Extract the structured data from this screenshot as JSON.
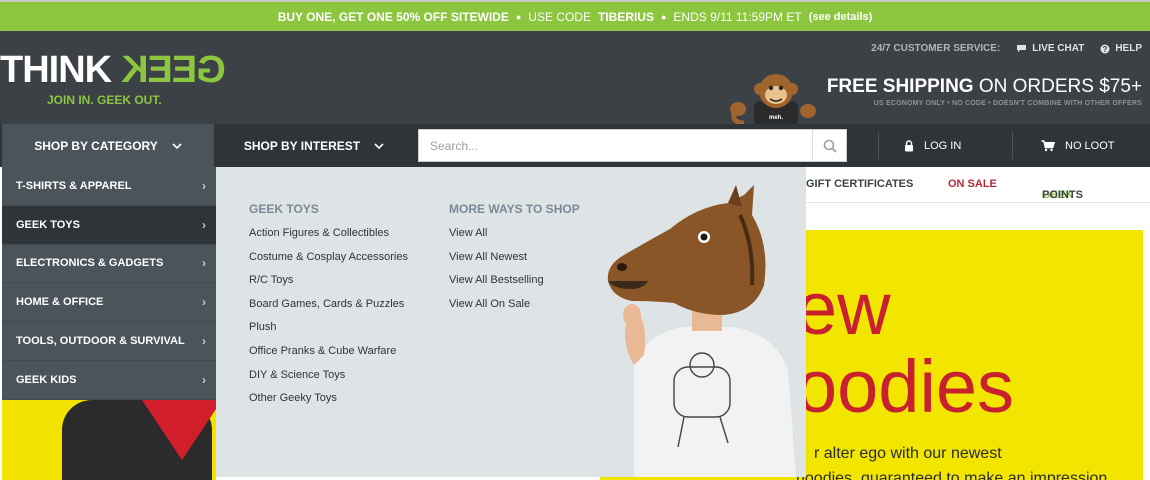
{
  "promo": {
    "offer": "BUY ONE, GET ONE 50% OFF SITEWIDE",
    "dot": "●",
    "code_label": "USE CODE",
    "code": "TIBERIUS",
    "ends": "ENDS 9/11 11:59PM ET",
    "details": "(see details)"
  },
  "header": {
    "logo_think": "THINK",
    "logo_geek": "GEEK",
    "tagline": "JOIN IN. GEEK OUT.",
    "service_label": "24/7 CUSTOMER SERVICE:",
    "live_chat": "LIVE CHAT",
    "help": "HELP",
    "shipping_bold": "FREE SHIPPING",
    "shipping_rest": " ON ORDERS $75+",
    "shipping_note": "US ECONOMY ONLY • NO CODE • DOESN'T COMBINE WITH OTHER OFFERS",
    "mascot_shirt": "meh."
  },
  "nav": {
    "shop_category": "SHOP BY CATEGORY",
    "shop_interest": "SHOP BY INTEREST",
    "search_placeholder": "Search...",
    "login": "LOG IN",
    "cart": "NO LOOT"
  },
  "subnav": {
    "gift": "GIFT CERTIFICATES",
    "sale": "ON SALE",
    "points_geek": "GEEK",
    "points_rest": "POINTS"
  },
  "categories": [
    {
      "label": "T-SHIRTS & APPAREL"
    },
    {
      "label": "GEEK TOYS"
    },
    {
      "label": "ELECTRONICS & GADGETS"
    },
    {
      "label": "HOME & OFFICE"
    },
    {
      "label": "TOOLS, OUTDOOR & SURVIVAL"
    },
    {
      "label": "GEEK KIDS"
    }
  ],
  "dropdown": {
    "col1_title": "GEEK TOYS",
    "col1_links": [
      "Action Figures & Collectibles",
      "Costume & Cosplay Accessories",
      "R/C Toys",
      "Board Games, Cards & Puzzles",
      "Plush",
      "Office Pranks & Cube Warfare",
      "DIY & Science Toys",
      "Other Geeky Toys"
    ],
    "col2_title": "MORE WAYS TO SHOP",
    "col2_links": [
      "View All",
      "View All Newest",
      "View All Bestselling",
      "View All On Sale"
    ]
  },
  "hero": {
    "line1": "ew",
    "line2": "oodies",
    "text1": "r alter ego with our newest",
    "text2": "hoodies, guaranteed to make an impression"
  },
  "colors": {
    "brand_green": "#8cc63f",
    "header_dark": "#3c4146",
    "sale_red": "#b4283c",
    "hero_yellow": "#f2e600"
  }
}
